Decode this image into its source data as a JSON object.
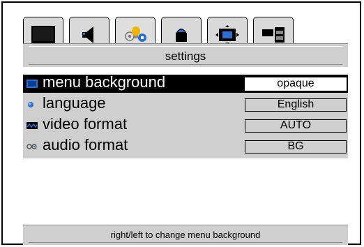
{
  "tabs": [
    {
      "icon": "picture-icon",
      "active": false
    },
    {
      "icon": "sound-icon",
      "active": false
    },
    {
      "icon": "settings-icon",
      "active": true
    },
    {
      "icon": "channel-icon",
      "active": false
    },
    {
      "icon": "screen-format-icon",
      "active": false
    },
    {
      "icon": "pip-icon",
      "active": false
    }
  ],
  "header": {
    "title": "settings"
  },
  "menu": {
    "items": [
      {
        "label": "menu background",
        "value": "opaque",
        "icon": "background-icon",
        "selected": true
      },
      {
        "label": "language",
        "value": "English",
        "icon": "language-icon",
        "selected": false
      },
      {
        "label": "video format",
        "value": "AUTO",
        "icon": "video-icon",
        "selected": false
      },
      {
        "label": "audio format",
        "value": "BG",
        "icon": "audio-icon",
        "selected": false
      }
    ]
  },
  "footer": {
    "hint": "right/left to change menu background"
  },
  "colors": {
    "panel": "#cfcfcf",
    "selected_row": "#000000",
    "selected_text": "#ffffff",
    "accent_blue": "#2a6fd6"
  }
}
